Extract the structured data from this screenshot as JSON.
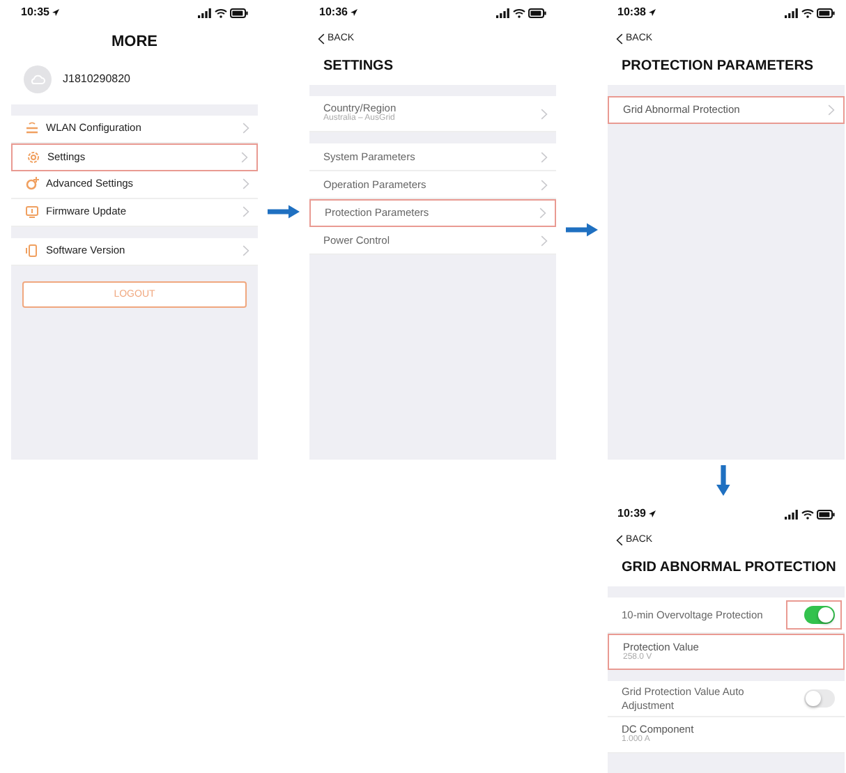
{
  "screens": [
    {
      "status_bar": {
        "time": "10:35"
      },
      "title": "MORE",
      "profile": {
        "name": "J1810290820"
      },
      "sections": [
        {
          "rows": [
            {
              "kind": "link",
              "label": "WLAN Configuration",
              "highlighted": false
            },
            {
              "kind": "link",
              "label": "Settings",
              "highlighted": true
            },
            {
              "kind": "link",
              "label": "Advanced Settings",
              "highlighted": false
            },
            {
              "kind": "link",
              "label": "Firmware Update",
              "highlighted": false
            }
          ]
        },
        {
          "rows": [
            {
              "kind": "link",
              "label": "Software Version",
              "highlighted": false
            }
          ]
        }
      ],
      "logout": "LOGOUT"
    },
    {
      "status_bar": {
        "time": "10:36"
      },
      "back": "BACK",
      "title": "SETTINGS",
      "sections": [
        {
          "rows": [
            {
              "kind": "link",
              "label": "Country/Region",
              "sublabel": "Australia – AusGrid",
              "highlighted": false
            }
          ]
        },
        {
          "rows": [
            {
              "kind": "link",
              "label": "System Parameters",
              "highlighted": false
            },
            {
              "kind": "link",
              "label": "Operation Parameters",
              "highlighted": false
            },
            {
              "kind": "link",
              "label": "Protection Parameters",
              "highlighted": true
            },
            {
              "kind": "link",
              "label": "Power Control",
              "highlighted": false
            }
          ]
        }
      ]
    },
    {
      "status_bar": {
        "time": "10:38"
      },
      "back": "BACK",
      "title": "PROTECTION PARAMETERS",
      "sections": [
        {
          "rows": [
            {
              "kind": "link",
              "label": "Grid Abnormal Protection",
              "highlighted": true
            }
          ]
        }
      ]
    },
    {
      "status_bar": {
        "time": "10:39"
      },
      "back": "BACK",
      "title": "GRID ABNORMAL PROTECTION",
      "sections": [
        {
          "rows": [
            {
              "kind": "toggle",
              "label": "10-min Overvoltage Protection",
              "on": true,
              "highlighted": true
            },
            {
              "kind": "value",
              "label": "Protection Value",
              "sublabel": "258.0 V",
              "highlighted": true
            }
          ]
        },
        {
          "rows": [
            {
              "kind": "toggle",
              "label": "Grid Protection Value Auto Adjustment",
              "on": false,
              "highlighted": false
            },
            {
              "kind": "value",
              "label": "DC Component",
              "sublabel": "1.000 A",
              "highlighted": false
            }
          ]
        }
      ]
    }
  ]
}
